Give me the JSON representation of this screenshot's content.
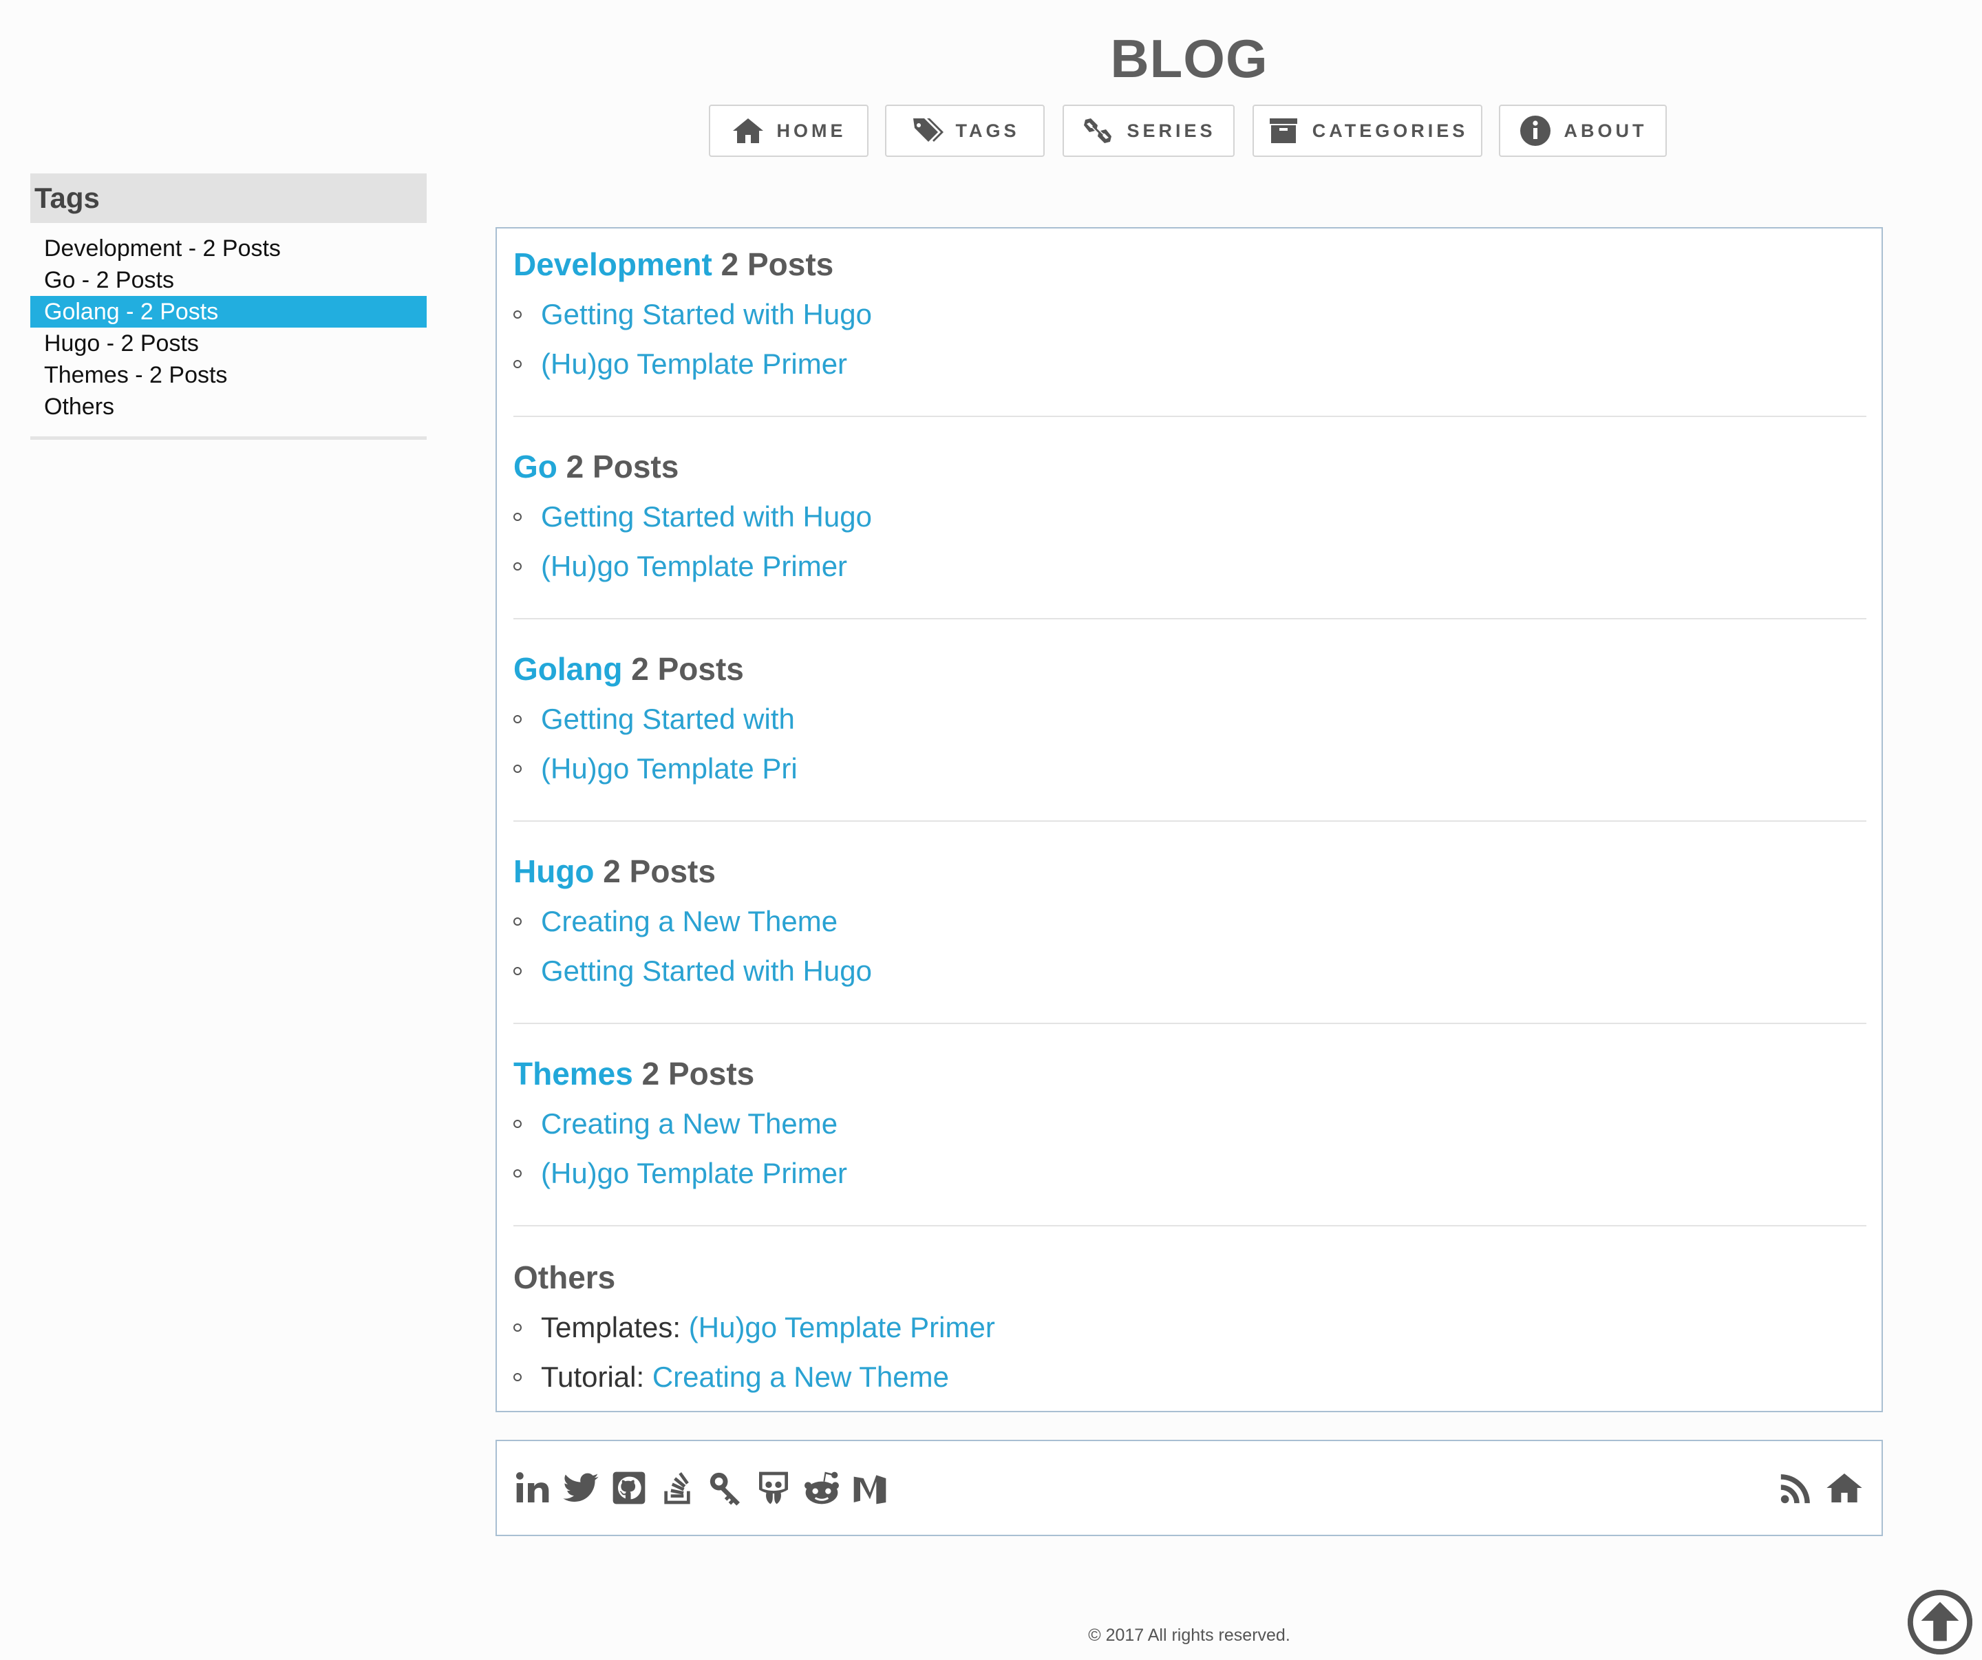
{
  "site": {
    "title": "BLOG"
  },
  "nav": [
    {
      "label": "HOME",
      "icon": "home-icon"
    },
    {
      "label": "TAGS",
      "icon": "tags-icon"
    },
    {
      "label": "SERIES",
      "icon": "link-icon"
    },
    {
      "label": "CATEGORIES",
      "icon": "archive-icon"
    },
    {
      "label": "ABOUT",
      "icon": "info-icon"
    }
  ],
  "sidebar": {
    "heading": "Tags",
    "items": [
      {
        "label": "Development - 2 Posts"
      },
      {
        "label": "Go - 2 Posts"
      },
      {
        "label": "Golang - 2 Posts",
        "active": true
      },
      {
        "label": "Hugo - 2 Posts"
      },
      {
        "label": "Themes - 2 Posts"
      },
      {
        "label": "Others"
      }
    ]
  },
  "groups": [
    {
      "tag": "Development",
      "count": "2 Posts",
      "posts": [
        "Getting Started with Hugo",
        "(Hu)go Template Primer"
      ]
    },
    {
      "tag": "Go",
      "count": "2 Posts",
      "posts": [
        "Getting Started with Hugo",
        "(Hu)go Template Primer"
      ]
    },
    {
      "tag": "Golang",
      "count": "2 Posts",
      "posts": [
        "Getting Started with",
        "(Hu)go Template Pri"
      ]
    },
    {
      "tag": "Hugo",
      "count": "2 Posts",
      "posts": [
        "Creating a New Theme",
        "Getting Started with Hugo"
      ]
    },
    {
      "tag": "Themes",
      "count": "2 Posts",
      "posts": [
        "Creating a New Theme",
        "(Hu)go Template Primer"
      ]
    }
  ],
  "others": {
    "heading": "Others",
    "items": [
      {
        "label": "Templates",
        "post": "(Hu)go Template Primer"
      },
      {
        "label": "Tutorial",
        "post": "Creating a New Theme"
      }
    ]
  },
  "social": {
    "left_icons": [
      "linkedin-icon",
      "twitter-icon",
      "github-icon",
      "stackoverflow-icon",
      "keybase-icon",
      "slideshare-icon",
      "reddit-icon",
      "medium-icon"
    ],
    "right_icons": [
      "rss-icon",
      "home-icon"
    ]
  },
  "footer": {
    "copyright": "© 2017 All rights reserved."
  },
  "colors": {
    "accent": "#22aedf",
    "link": "#2aa2d2",
    "border": "#a9bfd2",
    "text": "#555555"
  }
}
